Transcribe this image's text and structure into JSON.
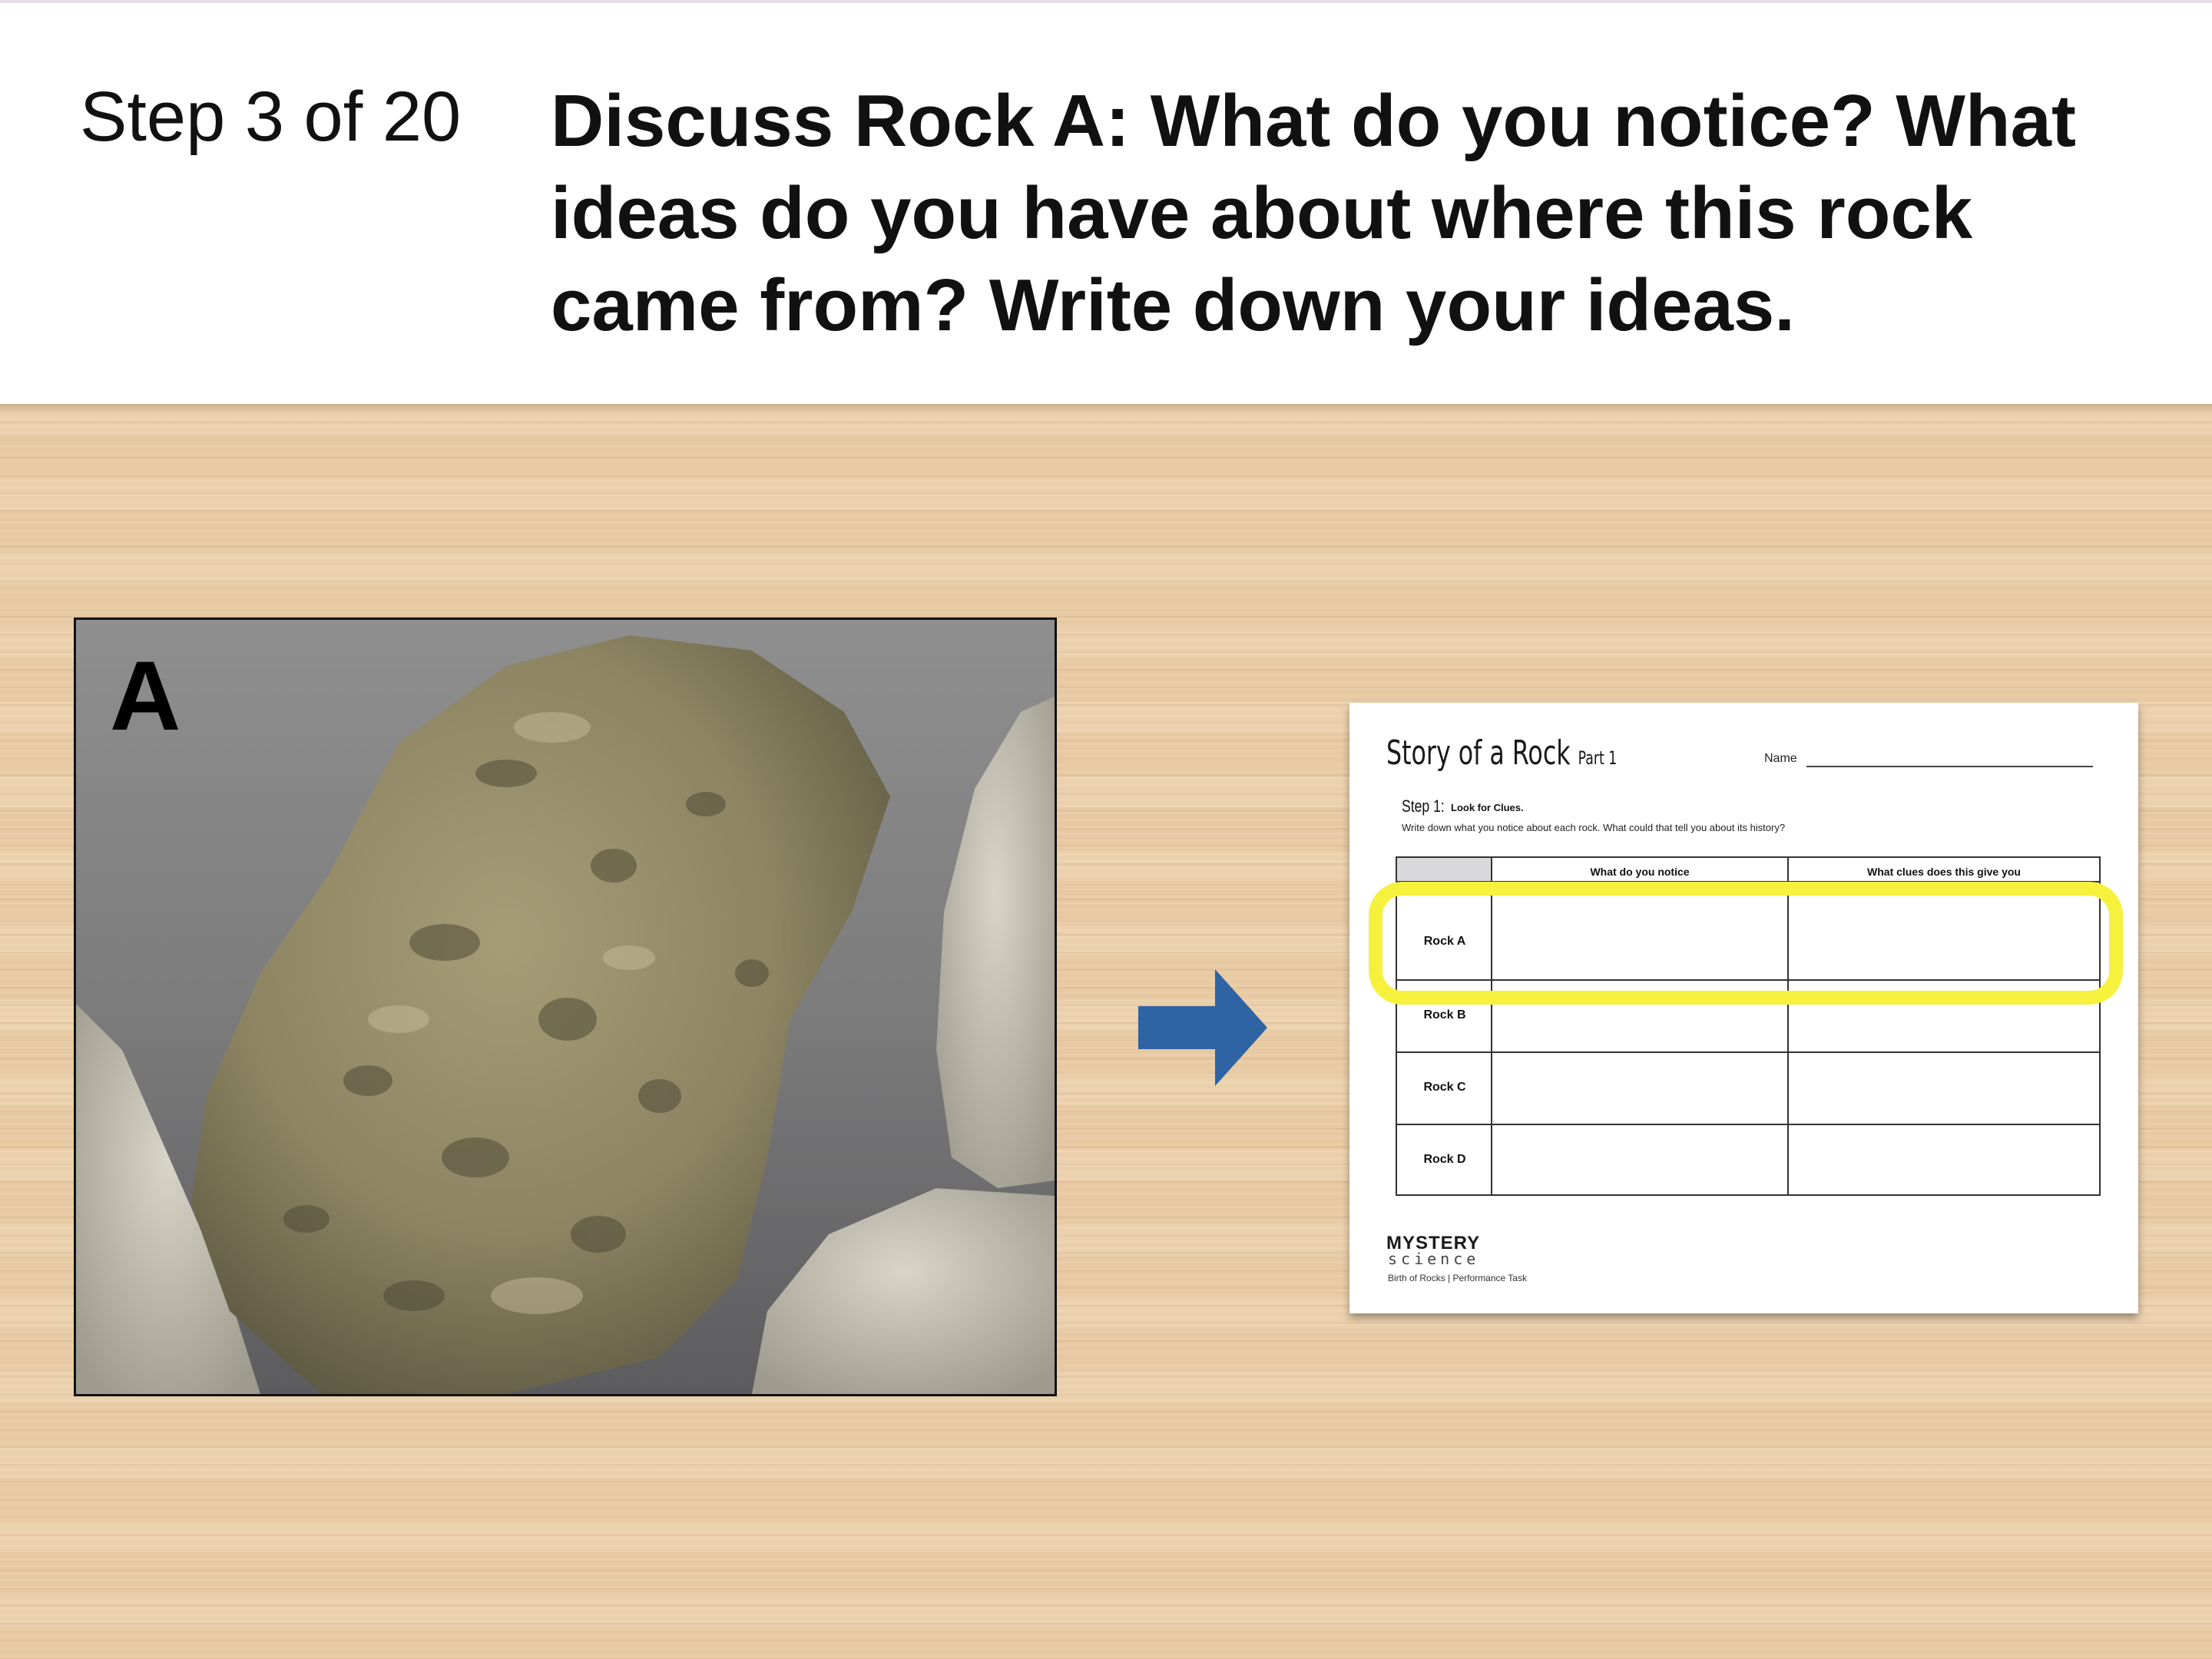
{
  "header": {
    "step_label": "Step 3 of 20",
    "instruction": "Discuss Rock A: What do you notice? What ideas do you have about where this rock came from? Write down your ideas."
  },
  "photo": {
    "letter": "A"
  },
  "worksheet": {
    "title": "Story of a Rock",
    "title_part": "Part 1",
    "name_label": "Name",
    "step_label": "Step 1:",
    "step_sub": "Look for Clues.",
    "instructions": "Write down what you notice about each rock. What could that tell you about its history?",
    "columns": [
      "What do you notice",
      "What clues does this give you"
    ],
    "rows": [
      "Rock A",
      "Rock B",
      "Rock C",
      "Rock D"
    ],
    "logo_top": "MYSTERY",
    "logo_bottom": "science",
    "footer": "Birth of Rocks | Performance Task"
  },
  "colors": {
    "highlight": "#f6f13d",
    "arrow": "#2e64a3",
    "wood": "#e7c9a2"
  }
}
